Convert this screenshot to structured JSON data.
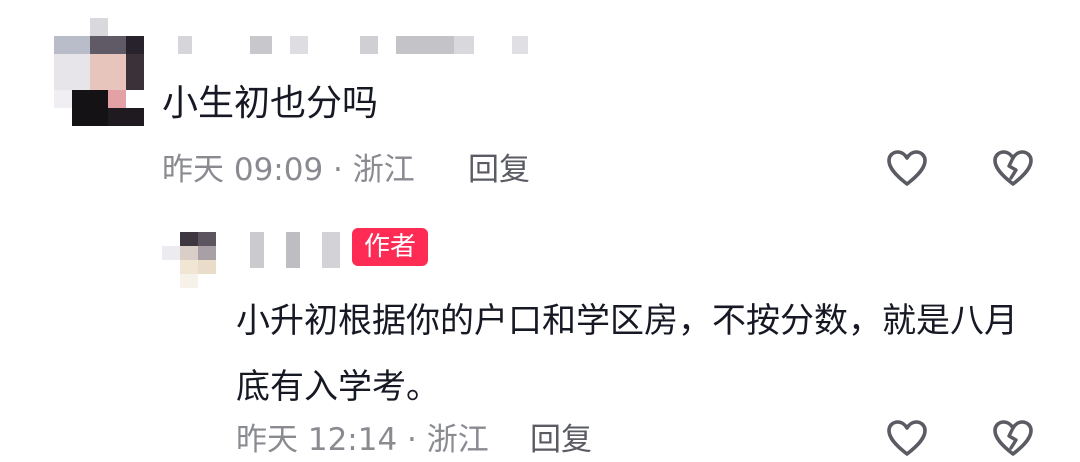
{
  "comments": [
    {
      "text": "小生初也分吗",
      "time": "昨天 09:09",
      "location": "浙江",
      "meta": "昨天 09:09 · 浙江",
      "reply_label": "回复",
      "like_icon": "heart-outline-icon",
      "dislike_icon": "broken-heart-icon"
    },
    {
      "badge": "作者",
      "text": "小升初根据你的户口和学区房，不按分数，就是八月底有入学考。",
      "time": "昨天 12:14",
      "location": "浙江",
      "meta": "昨天 12:14 · 浙江",
      "reply_label": "回复",
      "like_icon": "heart-outline-icon",
      "dislike_icon": "broken-heart-icon"
    }
  ],
  "colors": {
    "text_primary": "#161823",
    "text_meta": "#8a8b91",
    "author_badge_bg": "#fe2c55",
    "icon_stroke": "#5a5b63"
  }
}
